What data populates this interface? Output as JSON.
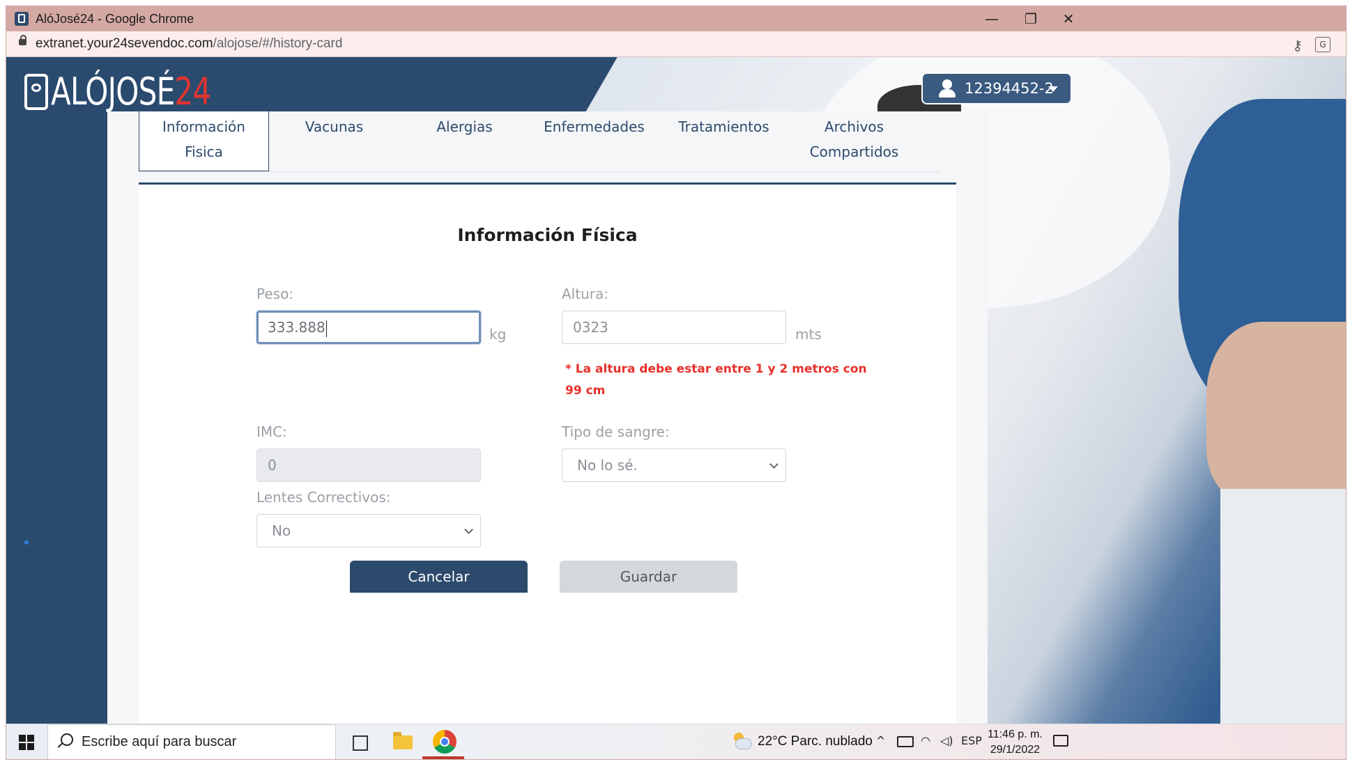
{
  "window": {
    "title": "AlóJosé24 - Google Chrome",
    "minimize_glyph": "—",
    "restore_glyph": "❐",
    "close_glyph": "✕"
  },
  "address_bar": {
    "url_host": "extranet.your24sevendoc.com",
    "url_path": "/alojose/#/history-card",
    "key_icon": "⚷",
    "translate_icon": "G"
  },
  "header": {
    "logo_text": "ALÓJOSÉ",
    "logo_number": "24",
    "user_id": "12394452-2"
  },
  "tabs": [
    {
      "label_line1": "Información",
      "label_line2": "Fisica",
      "active": true
    },
    {
      "label_line1": "Vacunas",
      "label_line2": ""
    },
    {
      "label_line1": "Alergias",
      "label_line2": ""
    },
    {
      "label_line1": "Enfermedades",
      "label_line2": ""
    },
    {
      "label_line1": "Tratamientos",
      "label_line2": ""
    },
    {
      "label_line1": "Archivos",
      "label_line2": "Compartidos"
    }
  ],
  "form": {
    "title": "Información Física",
    "peso": {
      "label": "Peso:",
      "value": "333.888",
      "unit": "kg"
    },
    "altura": {
      "label": "Altura:",
      "value": "0323",
      "unit": "mts",
      "error_line1": "* La altura debe estar entre 1 y 2 metros con",
      "error_line2": "99 cm"
    },
    "imc": {
      "label": "IMC:",
      "value": "0"
    },
    "tipo_sangre": {
      "label": "Tipo de sangre:",
      "selected": "No lo sé."
    },
    "lentes": {
      "label": "Lentes Correctivos:",
      "selected": "No"
    },
    "cancel_label": "Cancelar",
    "save_label": "Guardar"
  },
  "taskbar": {
    "search_placeholder": "Escribe aquí para buscar",
    "weather": "22°C  Parc. nublado",
    "tray_chevron": "^",
    "language": "ESP",
    "time": "11:46 p. m.",
    "date": "29/1/2022"
  },
  "colors": {
    "brand_navy": "#2c4a6b",
    "logo_accent": "#e3342f",
    "error_red": "#e8302a",
    "title_bar": "#d4a9a4"
  }
}
